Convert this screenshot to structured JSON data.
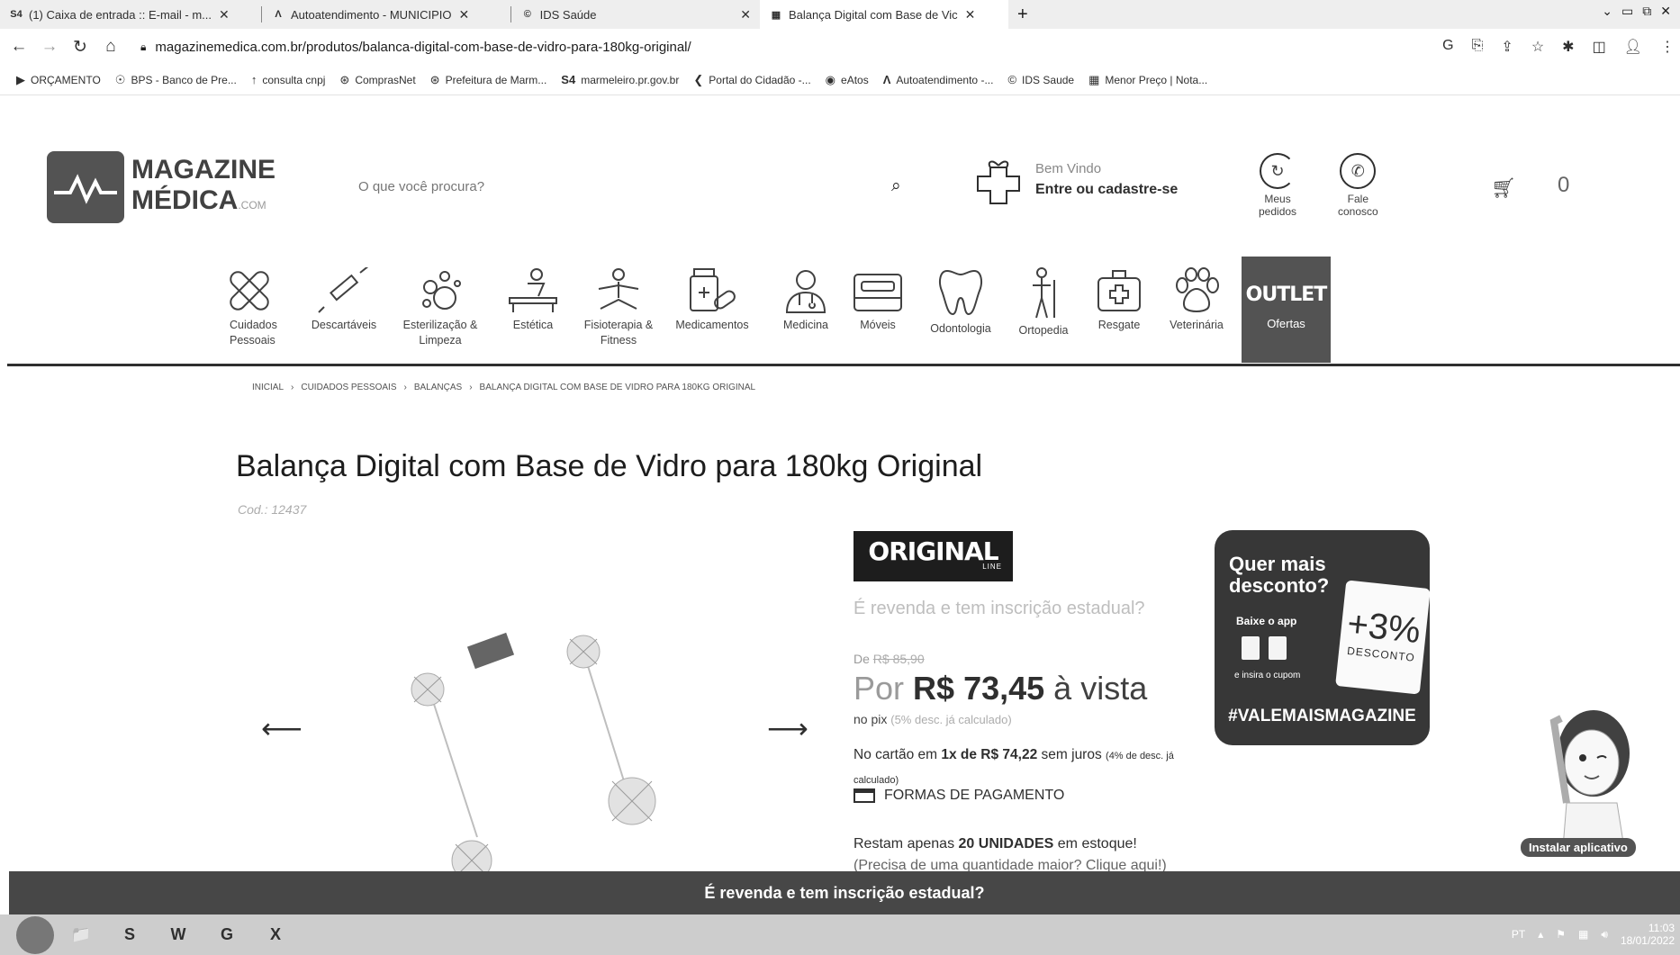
{
  "browser": {
    "tabs": [
      {
        "favicon": "S4",
        "title": "(1) Caixa de entrada :: E-mail - m...",
        "active": false
      },
      {
        "favicon": "Λ",
        "title": "Autoatendimento - MUNICIPIO",
        "active": false
      },
      {
        "favicon": "©",
        "title": "IDS Saúde",
        "active": false
      },
      {
        "favicon": "▦",
        "title": "Balança Digital com Base de Vic",
        "active": true
      }
    ],
    "new_tab": "+",
    "url": "magazinemedica.com.br/produtos/balanca-digital-com-base-de-vidro-para-180kg-original/",
    "bookmarks": [
      {
        "icon": "▶",
        "label": "ORÇAMENTO"
      },
      {
        "icon": "☉",
        "label": "BPS - Banco de Pre..."
      },
      {
        "icon": "↑",
        "label": "consulta cnpj"
      },
      {
        "icon": "⊛",
        "label": "ComprasNet"
      },
      {
        "icon": "⊛",
        "label": "Prefeitura de Marm..."
      },
      {
        "icon": "S4",
        "label": "marmeleiro.pr.gov.br"
      },
      {
        "icon": "❮",
        "label": "Portal do Cidadão -..."
      },
      {
        "icon": "◉",
        "label": "eAtos"
      },
      {
        "icon": "Λ",
        "label": "Autoatendimento -..."
      },
      {
        "icon": "©",
        "label": "IDS Saude"
      },
      {
        "icon": "▦",
        "label": "Menor Preço | Nota..."
      }
    ]
  },
  "header": {
    "logo_line1": "MAGAZINE",
    "logo_line2": "MÉDICA",
    "logo_suffix": ".COM",
    "search_placeholder": "O que você procura?",
    "welcome": "Bem Vindo",
    "login": "Entre ou cadastre-se",
    "orders_line1": "Meus",
    "orders_line2": "pedidos",
    "contact_line1": "Fale",
    "contact_line2": "conosco",
    "cart_count": "0"
  },
  "categories": [
    {
      "line1": "Cuidados",
      "line2": "Pessoais",
      "icon": "bandage-icon"
    },
    {
      "line1": "Descartáveis",
      "line2": "",
      "icon": "syringe-icon"
    },
    {
      "line1": "Esterilização &",
      "line2": "Limpeza",
      "icon": "bubbles-icon"
    },
    {
      "line1": "Estética",
      "line2": "",
      "icon": "massage-icon"
    },
    {
      "line1": "Fisioterapia &",
      "line2": "Fitness",
      "icon": "yoga-icon"
    },
    {
      "line1": "Medicamentos",
      "line2": "",
      "icon": "pills-icon"
    },
    {
      "line1": "Medicina",
      "line2": "",
      "icon": "doctor-icon"
    },
    {
      "line1": "Móveis",
      "line2": "",
      "icon": "bed-icon"
    },
    {
      "line1": "Odontologia",
      "line2": "",
      "icon": "tooth-icon"
    },
    {
      "line1": "Ortopedia",
      "line2": "",
      "icon": "crutch-icon"
    },
    {
      "line1": "Resgate",
      "line2": "",
      "icon": "firstaid-icon"
    },
    {
      "line1": "Veterinária",
      "line2": "",
      "icon": "paw-icon"
    }
  ],
  "outlet": {
    "title": "OUTLET",
    "label": "Ofertas"
  },
  "breadcrumb": [
    "INICIAL",
    "CUIDADOS PESSOAIS",
    "BALANÇAS",
    "BALANÇA DIGITAL COM BASE DE VIDRO PARA 180KG ORIGINAL"
  ],
  "product": {
    "title": "Balança Digital com Base de Vidro para 180kg Original",
    "code": "Cod.: 12437",
    "brand": "ORIGINAL",
    "brand_sub": "LINE",
    "revenda": "É revenda e tem inscrição estadual?",
    "old_price_label": "De",
    "old_price": "R$ 85,90",
    "price_prefix": "Por",
    "price": "R$ 73,45",
    "price_suffix": "à vista",
    "pix_label": "no pix",
    "pix_note": "(5% desc. já calculado)",
    "card_a": "No cartão em",
    "card_installments": "1x de R$ 74,22",
    "card_b": "sem juros",
    "card_note": "(4% de desc. já calculado)",
    "payment_methods": "FORMAS DE PAGAMENTO",
    "stock_a": "Restam apenas",
    "stock_units": "20 UNIDADES",
    "stock_b": "em estoque!",
    "stock_more": "(Precisa de uma quantidade maior? Clique aqui!)"
  },
  "promo": {
    "question": "Quer mais desconto?",
    "app": "Baixe o app",
    "coupon": "e insira o cupom",
    "discount": "+3%",
    "discount_label": "DESCONTO",
    "hashtag": "#VALEMAISMAGAZINE"
  },
  "install_app": "Instalar aplicativo",
  "bottom_bar": "É revenda e tem inscrição estadual?",
  "taskbar": {
    "apps": [
      "📁",
      "S",
      "W",
      "G",
      "X"
    ],
    "lang": "PT",
    "time": "11:03",
    "date": "18/01/2022"
  }
}
